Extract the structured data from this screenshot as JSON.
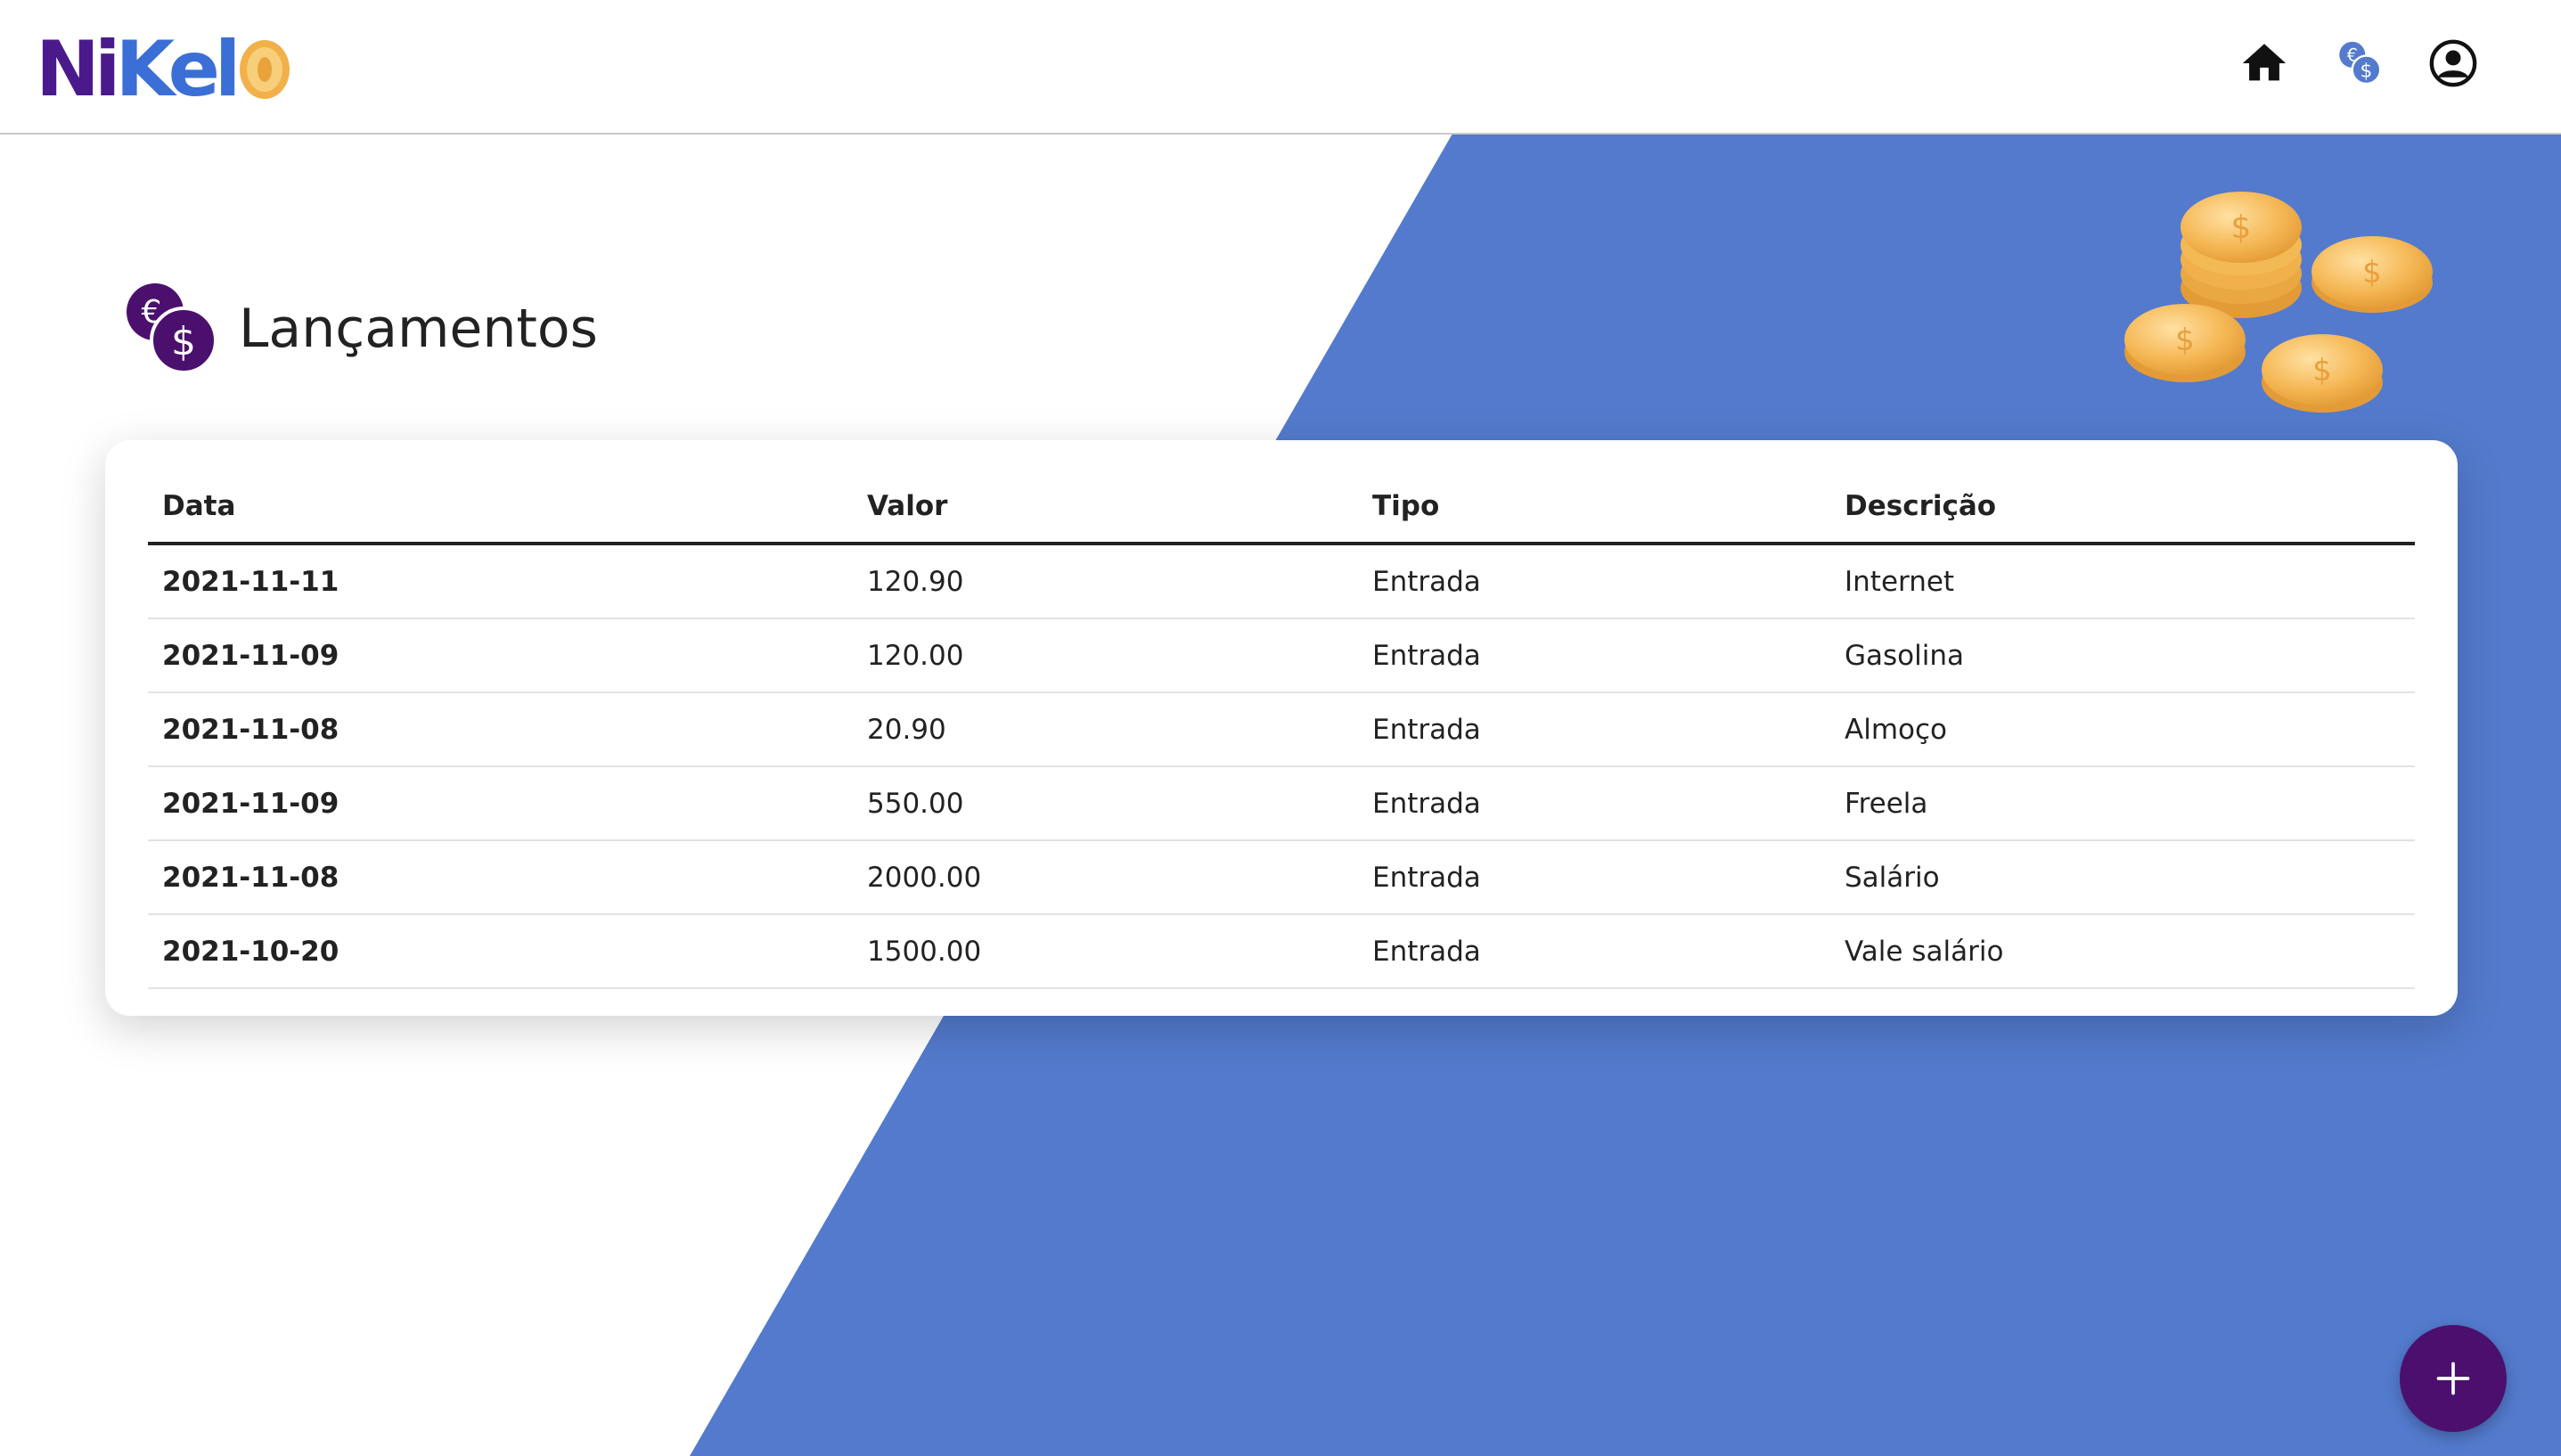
{
  "brand": {
    "logo_text_a": "Ni",
    "logo_text_b": "Kel",
    "accent_color": "#4b106d",
    "background_blue": "#537acd"
  },
  "navbar": {
    "icons": [
      "home-icon",
      "currency-icon",
      "user-account-icon"
    ]
  },
  "page": {
    "title": "Lançamentos",
    "header_icon": "currency-exchange-icon"
  },
  "table": {
    "columns": [
      "Data",
      "Valor",
      "Tipo",
      "Descrição"
    ],
    "rows": [
      {
        "date": "2021-11-11",
        "value": "120.90",
        "type": "Entrada",
        "description": "Internet"
      },
      {
        "date": "2021-11-09",
        "value": "120.00",
        "type": "Entrada",
        "description": "Gasolina"
      },
      {
        "date": "2021-11-08",
        "value": "20.90",
        "type": "Entrada",
        "description": "Almoço"
      },
      {
        "date": "2021-11-09",
        "value": "550.00",
        "type": "Entrada",
        "description": "Freela"
      },
      {
        "date": "2021-11-08",
        "value": "2000.00",
        "type": "Entrada",
        "description": "Salário"
      },
      {
        "date": "2021-10-20",
        "value": "1500.00",
        "type": "Entrada",
        "description": "Vale salário"
      }
    ]
  },
  "fab": {
    "icon": "plus-icon"
  }
}
